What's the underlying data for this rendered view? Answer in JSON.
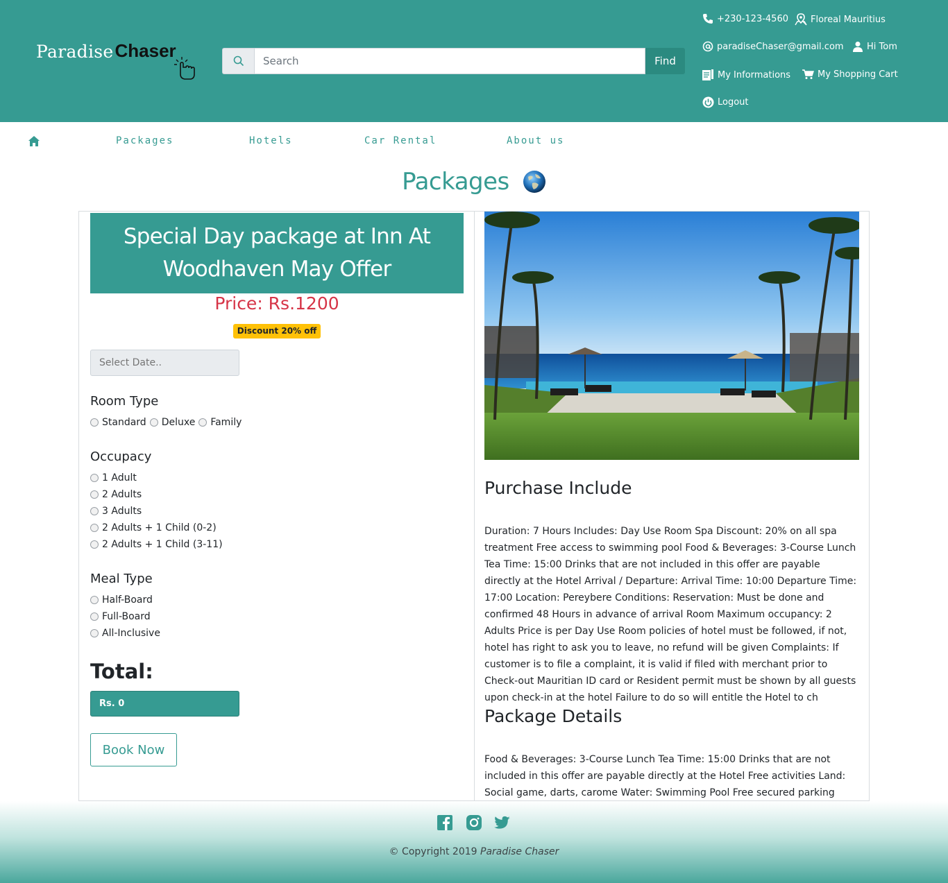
{
  "brand": {
    "name_part1": "Paradise",
    "name_part2": "Chaser"
  },
  "search": {
    "placeholder": "Search",
    "button_label": "Find"
  },
  "contact": {
    "phone": "+230-123-4560",
    "location": "Floreal Mauritius",
    "email": "paradiseChaser@gmail.com",
    "greeting": "Hi Tom",
    "my_info": "My Informations",
    "cart": "My Shopping Cart",
    "logout": "Logout"
  },
  "nav": {
    "items": [
      "Packages",
      "Hotels",
      "Car Rental",
      "About us"
    ]
  },
  "page": {
    "title": "Packages"
  },
  "package": {
    "title": "Special Day package at Inn At Woodhaven May Offer",
    "price": "Price: Rs.1200",
    "discount": "Discount 20% off",
    "date_placeholder": "Select Date..",
    "room_type": {
      "heading": "Room Type",
      "options": [
        "Standard",
        "Deluxe",
        "Family"
      ]
    },
    "occupancy": {
      "heading": "Occupacy",
      "options": [
        "1 Adult",
        "2 Adults",
        "3 Adults",
        "2 Adults + 1 Child (0-2)",
        "2 Adults + 1 Child (3-11)"
      ]
    },
    "meal_type": {
      "heading": "Meal Type",
      "options": [
        "Half-Board",
        "Full-Board",
        "All-Inclusive"
      ]
    },
    "total_label": "Total:",
    "total_value": "Rs. 0",
    "book_label": "Book Now"
  },
  "details": {
    "purchase_heading": "Purchase Include",
    "purchase_text": "Duration: 7 Hours Includes: Day Use Room Spa Discount: 20% on all spa treatment Free access to swimming pool Food & Beverages: 3-Course Lunch Tea Time: 15:00 Drinks that are not included in this offer are payable directly at the Hotel Arrival / Departure: Arrival Time: 10:00 Departure Time: 17:00 Location: Pereybere Conditions: Reservation: Must be done and confirmed 48 Hours in advance of arrival Room Maximum occupancy: 2 Adults Price is per Day Use Room policies of hotel must be followed, if not, hotel has right to ask you to leave, no refund will be given Complaints: If customer is to file a complaint, it is valid if filed with merchant prior to Check-out Mauritian ID card or Resident permit must be shown by all guests upon check-in at the hotel Failure to do so will entitle the Hotel to ch",
    "package_heading": "Package Details",
    "package_text": "Food & Beverages: 3-Course Lunch Tea Time: 15:00 Drinks that are not included in this offer are payable directly at the Hotel Free activities Land: Social game, darts, carome Water: Swimming Pool Free secured parking"
  },
  "footer": {
    "copyright_prefix": "© Copyright 2019",
    "copyright_brand": "Paradise Chaser",
    "social_icons": [
      "facebook-icon",
      "instagram-icon",
      "twitter-icon"
    ]
  },
  "colors": {
    "primary": "#369b92",
    "price": "#d63447",
    "badge": "#ffc107"
  }
}
